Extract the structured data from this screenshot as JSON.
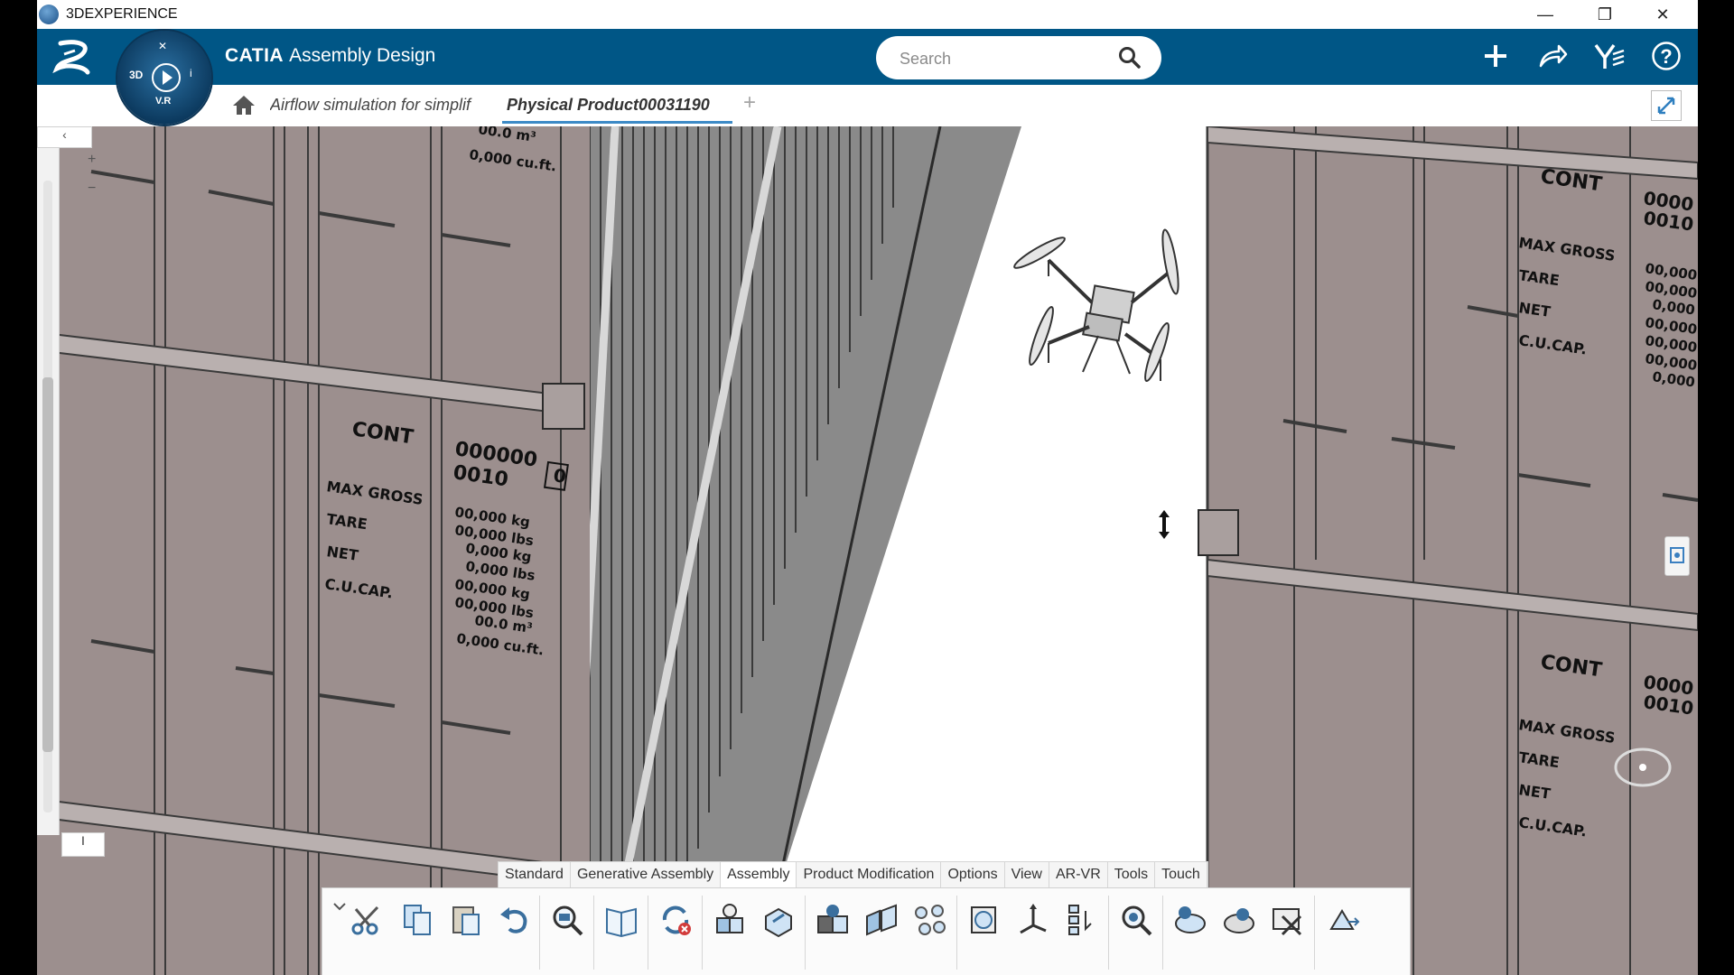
{
  "window": {
    "title": "3DEXPERIENCE",
    "minimize": "—",
    "restore": "❐",
    "close": "✕"
  },
  "topbar": {
    "brand": "CATIA",
    "module": "Assembly Design",
    "compass": {
      "label_3d": "3D",
      "label_vr": "V.R"
    },
    "search_placeholder": "Search",
    "icons": [
      "plus-icon",
      "share-icon",
      "collaboration-icon",
      "help-icon"
    ]
  },
  "tabs": {
    "breadcrumb": "Airflow simulation for simplif",
    "active_tab": "Physical Product00031190",
    "add": "+"
  },
  "tree": {
    "collapse": "‹",
    "plus": "+",
    "minus": "−",
    "bottom": "I"
  },
  "scene": {
    "left_container": {
      "cont": "CONT",
      "code_line1": "000000",
      "code_line2": "0010",
      "check_digit": "0",
      "fields": [
        "MAX GROSS",
        "TARE",
        "NET",
        "C.U.CAP."
      ],
      "values": [
        "00,000 kg",
        "00,000 lbs",
        "0,000 kg",
        "0,000 lbs",
        "00,000 kg",
        "00,000 lbs",
        "00.0 m³",
        "0,000 cu.ft."
      ],
      "top_values": [
        "00.0 m³",
        "0,000 cu.ft."
      ]
    },
    "right_container": {
      "cont": "CONT",
      "code_line1": "0000",
      "code_line2": "0010",
      "fields": [
        "MAX GROSS",
        "TARE",
        "NET",
        "C.U.CAP."
      ],
      "values": [
        "00,000",
        "00,000",
        "0,000",
        "00,000",
        "00,000",
        "00,000",
        "0,000"
      ]
    }
  },
  "action_bar": {
    "sections": [
      "Standard",
      "Generative Assembly",
      "Assembly",
      "Product Modification",
      "Options",
      "View",
      "AR-VR",
      "Tools",
      "Touch"
    ],
    "active_section": "Assembly",
    "tools": [
      "cut-icon",
      "copy-icon",
      "paste-icon",
      "undo-icon",
      "zoom-inspect-icon",
      "catalog-icon",
      "delete-update-icon",
      "insert-product-icon",
      "existing-component-icon",
      "replace-component-icon",
      "engineering-connection-icon",
      "explode-icon",
      "pattern-icon",
      "section-icon",
      "robot-icon",
      "tree-reorder-icon",
      "zoom-fit-icon",
      "analysis-icon",
      "clash-icon",
      "remove-icon",
      "compass-move-icon"
    ]
  }
}
